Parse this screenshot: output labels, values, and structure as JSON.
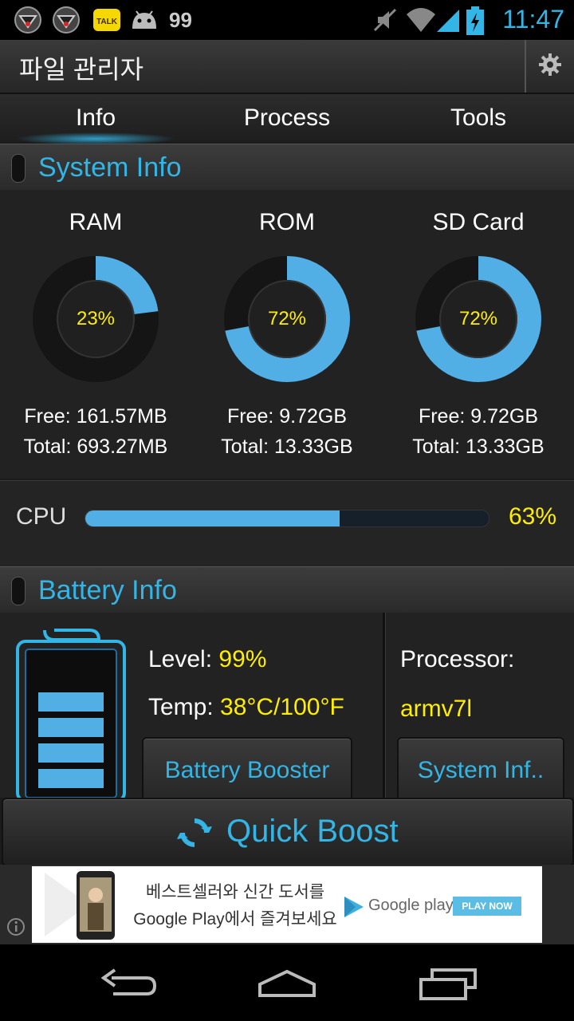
{
  "status_bar": {
    "time": "11:47",
    "notification_count": "99",
    "icons": [
      "app-icon-1",
      "app-icon-2",
      "kakaotalk-icon",
      "android-icon",
      "mute-icon",
      "wifi-icon",
      "signal-icon",
      "battery-charging-icon"
    ],
    "kakaotalk_text": "TALK"
  },
  "app": {
    "title": "파일 관리자"
  },
  "tabs": [
    {
      "label": "Info"
    },
    {
      "label": "Process"
    },
    {
      "label": "Tools"
    }
  ],
  "system_info": {
    "header": "System Info",
    "gauges": [
      {
        "label": "RAM",
        "percent_text": "23%",
        "percent": 23,
        "free": "Free: 161.57MB",
        "total": "Total: 693.27MB"
      },
      {
        "label": "ROM",
        "percent_text": "72%",
        "percent": 72,
        "free": "Free: 9.72GB",
        "total": "Total: 13.33GB"
      },
      {
        "label": "SD Card",
        "percent_text": "72%",
        "percent": 72,
        "free": "Free: 9.72GB",
        "total": "Total: 13.33GB"
      }
    ],
    "cpu": {
      "label": "CPU",
      "percent_text": "63%",
      "percent": 63
    }
  },
  "battery_info": {
    "header": "Battery Info",
    "level_label": "Level: ",
    "level_value": "99%",
    "temp_label": "Temp: ",
    "temp_value": "38°C/100°F",
    "processor_label": "Processor:",
    "processor_value": "armv7l",
    "battery_booster_label": "Battery Booster",
    "system_info_button_label": "System Inf..",
    "battery_level_fraction": 0.99
  },
  "quick_boost": {
    "label": "Quick Boost"
  },
  "ad": {
    "line1": "베스트셀러와 신간 도서를",
    "line2": "Google Play에서 즐겨보세요",
    "brand": "Google play",
    "cta": "PLAY NOW"
  },
  "colors": {
    "accent": "#33b5e5",
    "gauge_fill": "#52afe5",
    "value_yellow": "#ffee00",
    "background": "#222222"
  }
}
